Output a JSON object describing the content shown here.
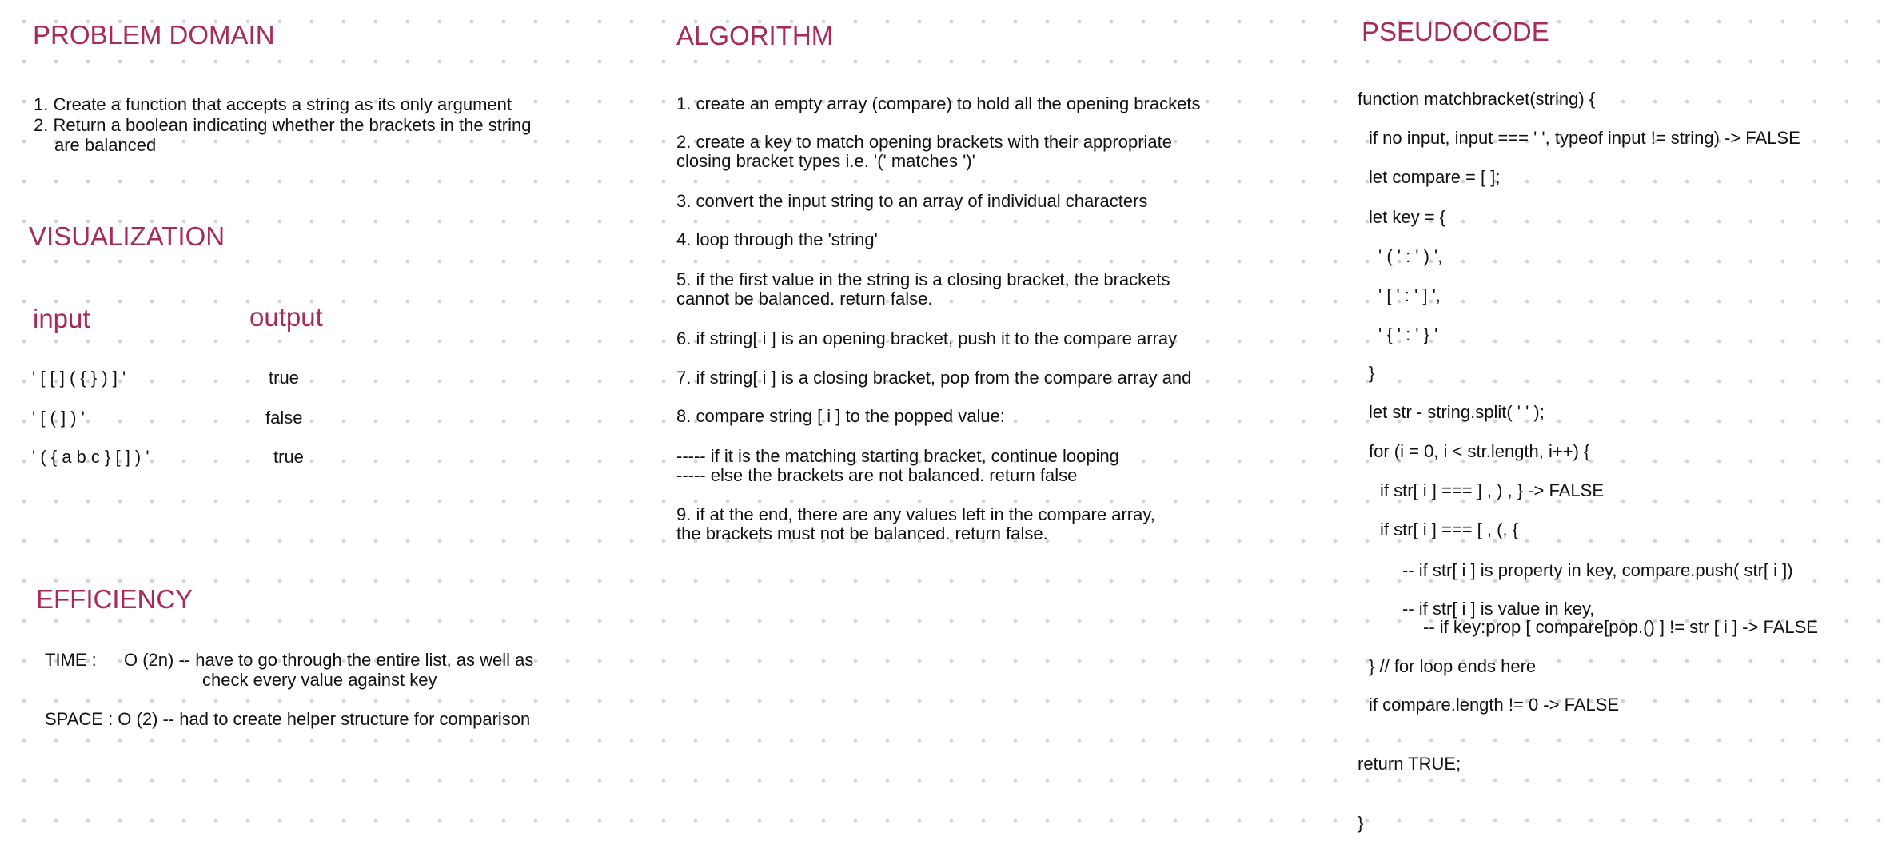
{
  "problem_domain": {
    "heading": "PROBLEM DOMAIN",
    "items": [
      "1. Create a function that accepts a string as its only argument",
      "2. Return a boolean indicating whether the brackets in the string",
      "are balanced"
    ]
  },
  "visualization": {
    "heading": "VISUALIZATION",
    "input_label": "input",
    "output_label": "output",
    "rows": [
      {
        "input": "' [ [ ] ( { } ) ] '",
        "output": "true"
      },
      {
        "input": "' [ ( ] ) '",
        "output": "false"
      },
      {
        "input": "' ( { a b c } [ ] ) '",
        "output": "true"
      }
    ]
  },
  "efficiency": {
    "heading": "EFFICIENCY",
    "time_label": "TIME :",
    "time_line1": "O (2n) -- have to go through the entire list, as well as",
    "time_line2": "check every value against key",
    "space_line": "SPACE : O (2) -- had to create helper structure for comparison"
  },
  "algorithm": {
    "heading": "ALGORITHM",
    "lines": [
      "1. create an empty array (compare) to hold all the opening brackets",
      "2. create a key to match opening brackets with their appropriate",
      "closing bracket types i.e. '(' matches ')'",
      "3. convert the input string to an array of individual characters",
      "4. loop through the 'string'",
      "5. if the first value in the string is a closing bracket, the brackets",
      "cannot be balanced. return false.",
      "6. if string[ i ] is an opening bracket, push it to the compare array",
      "7. if string[ i ] is a closing bracket, pop from the compare array and",
      "8. compare string [ i ] to the popped value:",
      "----- if it is the matching starting bracket, continue looping",
      "----- else the brackets are not balanced. return false",
      "9. if at the end, there are any values left in the compare array,",
      "the brackets must not be balanced. return false."
    ]
  },
  "pseudocode": {
    "heading": "PSEUDOCODE",
    "lines": [
      "function matchbracket(string) {",
      "if no input, input === ' ', typeof input != string) -> FALSE",
      "let compare = [ ];",
      "let key = {",
      "' ( ' : ' ) ',",
      "' [ ' : ' ] ',",
      "' { ' : ' } '",
      "}",
      "let str - string.split( ' ' );",
      "for (i = 0, i < str.length, i++) {",
      "if str[ i ] === ] , ) , } -> FALSE",
      "if str[ i ] === [ , (, {",
      "-- if str[ i ] is property in key, compare.push( str[ i ])",
      "-- if str[ i ] is value in key,",
      "-- if key:prop [ compare[pop.() ] != str [ i ] -> FALSE",
      "} // for loop ends here",
      "if compare.length != 0 -> FALSE",
      "return TRUE;",
      "}"
    ]
  }
}
